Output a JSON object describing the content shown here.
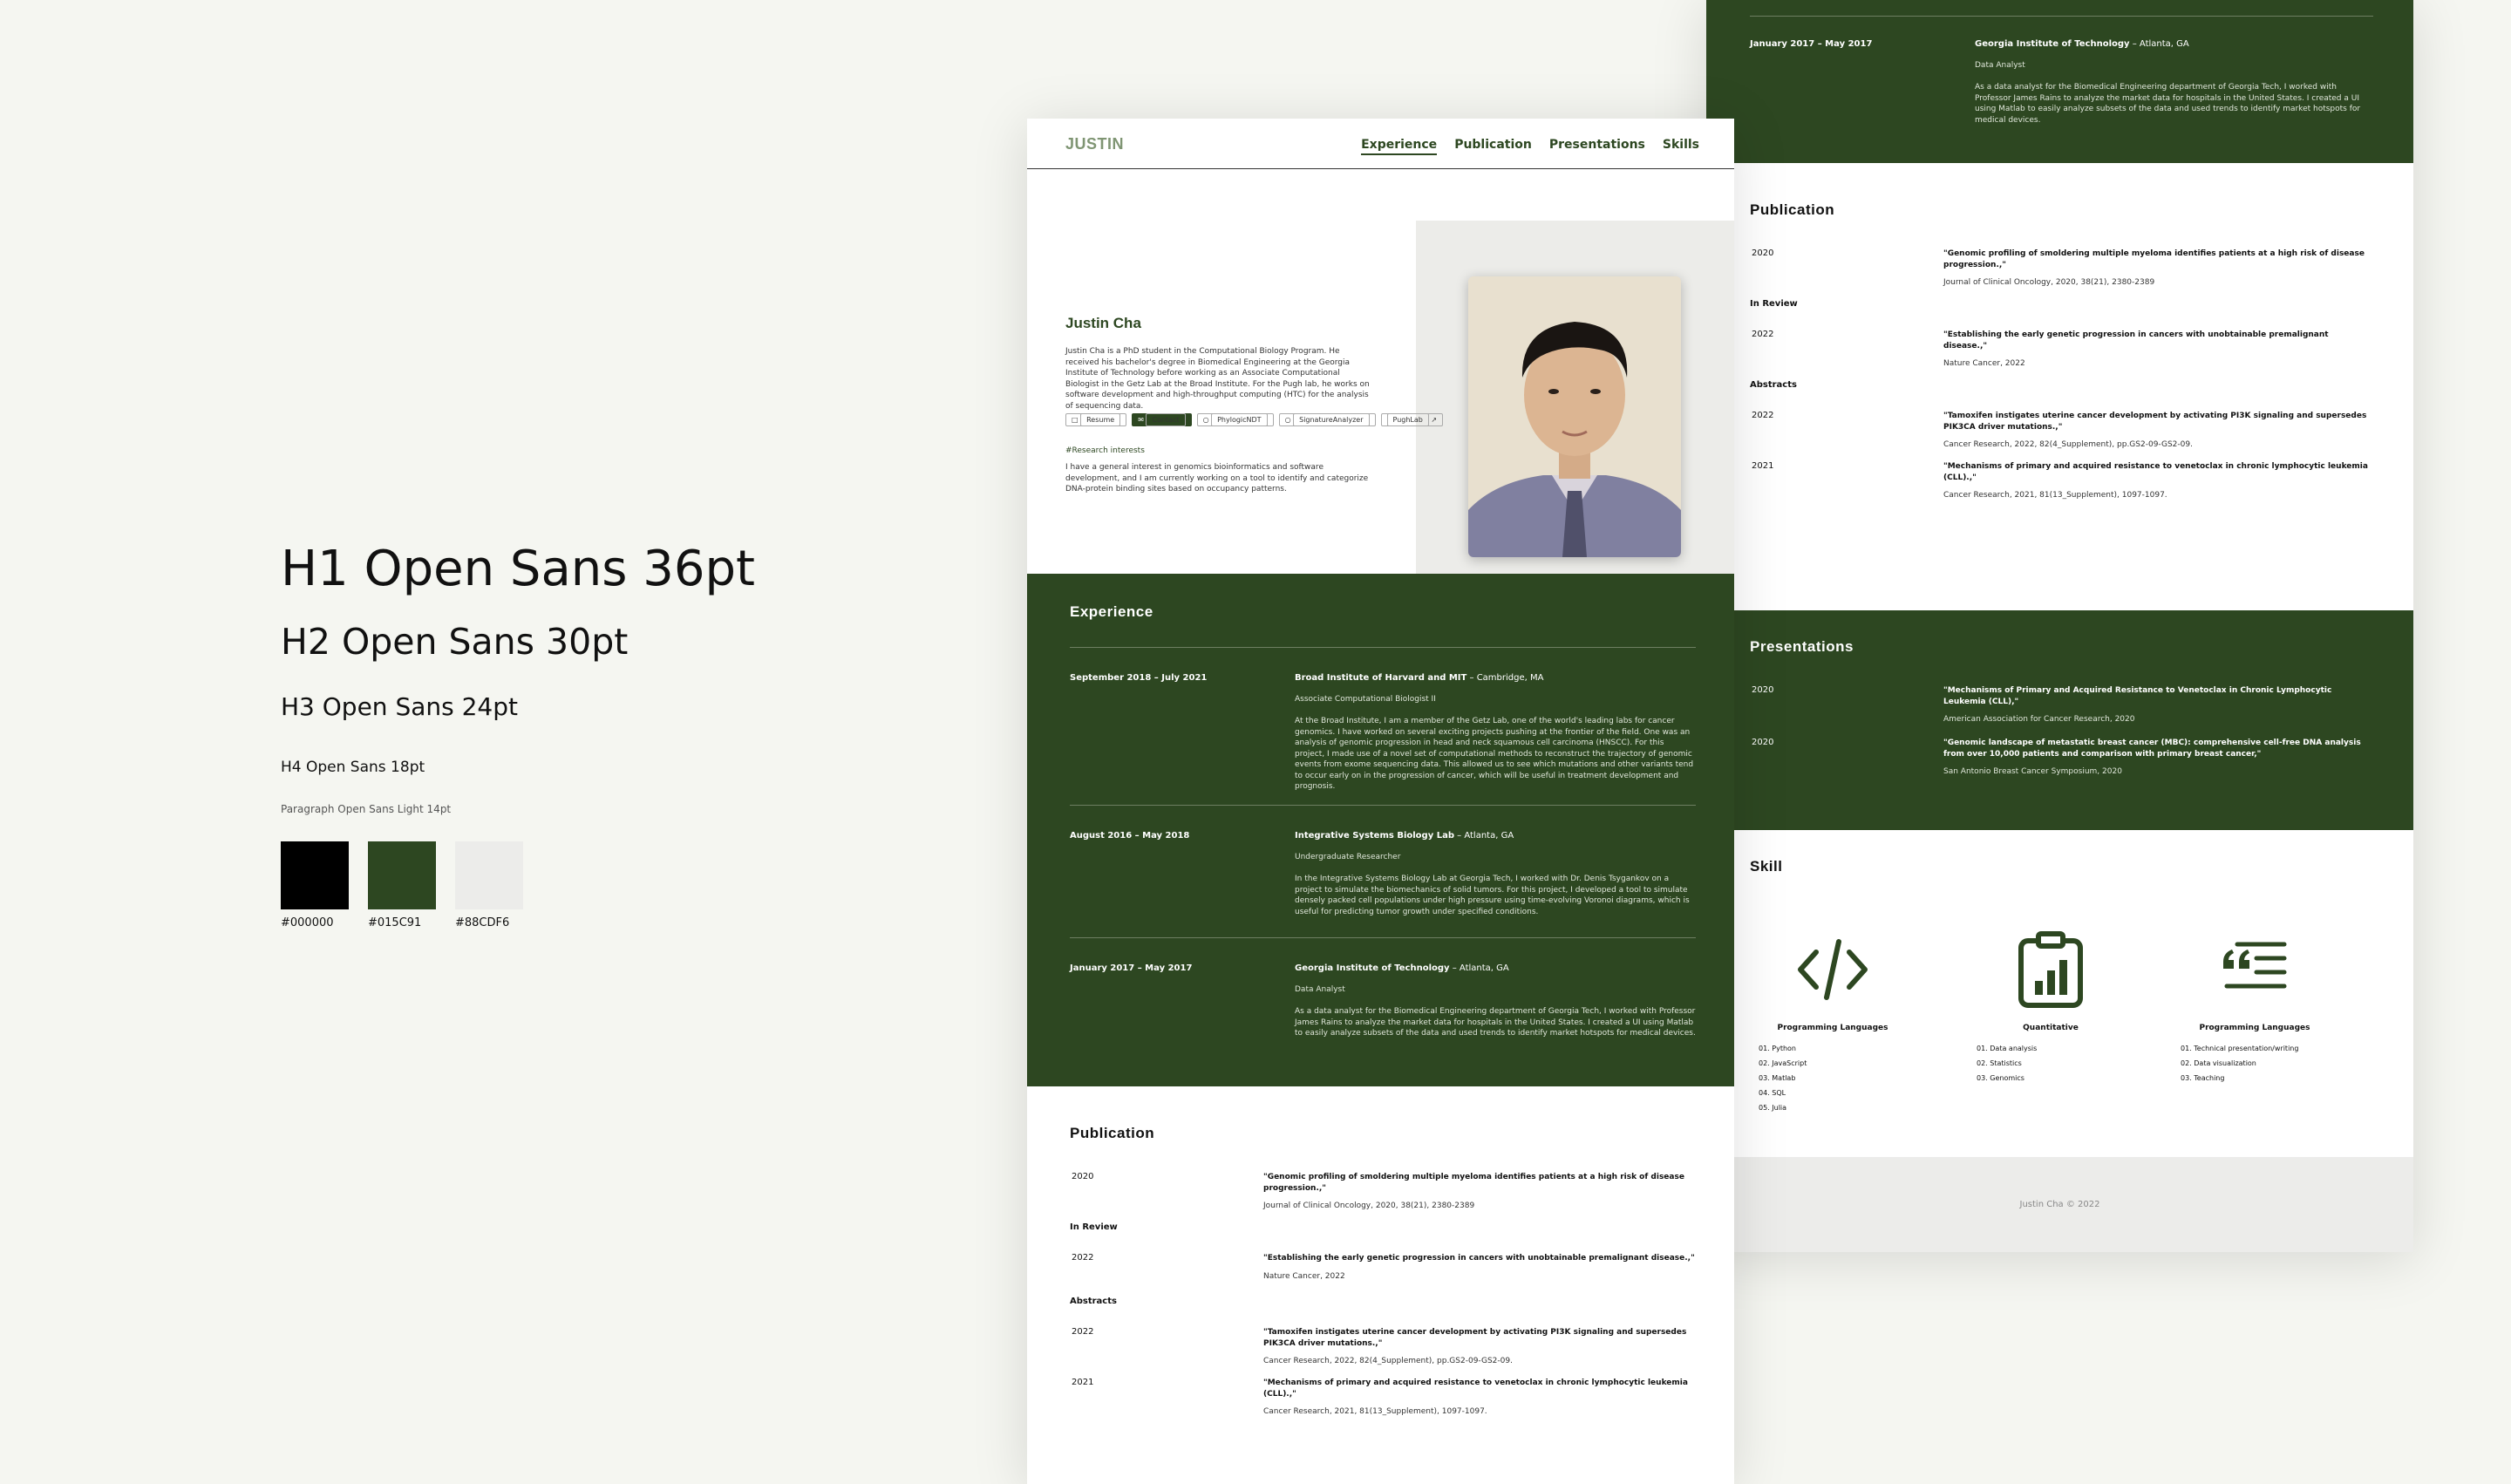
{
  "style_guide": {
    "h1": "H1 Open Sans 36pt",
    "h2": "H2 Open Sans 30pt",
    "h3": "H3 Open Sans 24pt",
    "h4": "H4 Open Sans 18pt",
    "paragraph": "Paragraph Open Sans Light 14pt",
    "swatches": [
      {
        "color": "#000000",
        "label": "#000000"
      },
      {
        "color": "#2d4721",
        "label": "#015C91"
      },
      {
        "color": "#ececea",
        "label": "#88CDF6"
      }
    ]
  },
  "nav": {
    "logo": "JUSTIN",
    "items": [
      "Experience",
      "Publication",
      "Presentations",
      "Skills"
    ]
  },
  "hero": {
    "name": "Justin Cha",
    "bio": "Justin Cha is a PhD student in the Computational Biology Program. He received his bachelor's degree in Biomedical Engineering at the Georgia Institute of Technology before working as an Associate Computational Biologist in the Getz Lab at the Broad Institute. For the Pugh lab, he works on software development and high-throughput computing (HTC) for the analysis of sequencing data.",
    "buttons": [
      "Resume",
      "Contact",
      "PhylogicNDT",
      "SignatureAnalyzer",
      "PughLab"
    ],
    "research_title": "#Research interests",
    "research_text": "I have a general interest in genomics bioinformatics and software development, and I am currently working on a tool to identify and categorize DNA-protein binding sites based on occupancy patterns."
  },
  "experience": {
    "title": "Experience",
    "items": [
      {
        "date": "September 2018 – July 2021",
        "org": "Broad Institute of Harvard and MIT",
        "location": " – Cambridge, MA",
        "role": "Associate Computational Biologist II",
        "desc": "At the Broad Institute, I am a member of the Getz Lab, one of the world's leading labs for cancer genomics. I have worked on several exciting projects pushing at the frontier of the field. One was an analysis of genomic progression in head and neck squamous cell carcinoma (HNSCC). For this project, I made use of a novel set of computational methods to reconstruct the trajectory of genomic events from exome sequencing data. This allowed us to see which mutations and other variants tend to occur early on in the progression of cancer, which will be useful in treatment development and prognosis."
      },
      {
        "date": "August 2016 – May 2018",
        "org": "Integrative Systems Biology Lab",
        "location": " – Atlanta, GA",
        "role": "Undergraduate Researcher",
        "desc": "In the Integrative Systems Biology Lab at Georgia Tech, I worked with Dr. Denis Tsygankov on a project to simulate the biomechanics of solid tumors. For this project, I developed a tool to simulate densely packed cell populations under high pressure using time-evolving Voronoi diagrams, which is useful for predicting tumor growth under specified conditions."
      },
      {
        "date": "January 2017 – May 2017",
        "org": "Georgia Institute of Technology",
        "location": " – Atlanta, GA",
        "role": "Data Analyst",
        "desc": "As a data analyst for the Biomedical Engineering department of Georgia Tech, I worked with Professor James Rains to analyze the market data for hospitals in the United States. I created a UI using Matlab to easily analyze subsets of the data and used trends to identify market hotspots for medical devices."
      }
    ]
  },
  "publication": {
    "title": "Publication",
    "published": [
      {
        "year": "2020",
        "title": "\"Genomic profiling of smoldering multiple myeloma identifies patients at a high risk of disease progression.,\"",
        "journal": "Journal of Clinical Oncology, 2020, 38(21), 2380-2389"
      }
    ],
    "in_review_label": "In Review",
    "in_review": [
      {
        "year": "2022",
        "title": "\"Establishing the early genetic progression in cancers with unobtainable premalignant disease.,\"",
        "journal": "Nature Cancer, 2022"
      }
    ],
    "abstracts_label": "Abstracts",
    "abstracts": [
      {
        "year": "2022",
        "title": "\"Tamoxifen instigates uterine cancer development by activating PI3K signaling and supersedes PIK3CA driver mutations.,\"",
        "journal": "Cancer Research, 2022, 82(4_Supplement), pp.GS2-09-GS2-09."
      },
      {
        "year": "2021",
        "title": "\"Mechanisms of primary and acquired resistance to venetoclax in chronic lymphocytic leukemia (CLL).,\"",
        "journal": "Cancer Research, 2021, 81(13_Supplement), 1097-1097."
      }
    ]
  },
  "presentations": {
    "title": "Presentations",
    "items": [
      {
        "year": "2020",
        "title": "\"Mechanisms of Primary and Acquired Resistance to Venetoclax in Chronic Lymphocytic Leukemia (CLL),\"",
        "venue": "American Association for Cancer Research, 2020"
      },
      {
        "year": "2020",
        "title": "\"Genomic landscape of metastatic breast cancer (MBC): comprehensive cell-free DNA analysis from over 10,000 patients and comparison with primary breast cancer,\"",
        "venue": "San Antonio Breast Cancer Symposium, 2020"
      }
    ]
  },
  "skill": {
    "title": "Skill",
    "columns": [
      {
        "icon": "code-icon",
        "title": "Programming Languages",
        "items": [
          "01.  Python",
          "02.  JavaScript",
          "03.  Matlab",
          "04.  SQL",
          "05.  Julia"
        ]
      },
      {
        "icon": "clipboard-chart-icon",
        "title": "Quantitative",
        "items": [
          "01.  Data analysis",
          "02.  Statistics",
          "03.  Genomics"
        ]
      },
      {
        "icon": "quote-list-icon",
        "title": "Programming Languages",
        "items": [
          "01.  Technical presentation/writing",
          "02.  Data visualization",
          "03.  Teaching"
        ]
      }
    ]
  },
  "footer": "Justin Cha © 2022"
}
